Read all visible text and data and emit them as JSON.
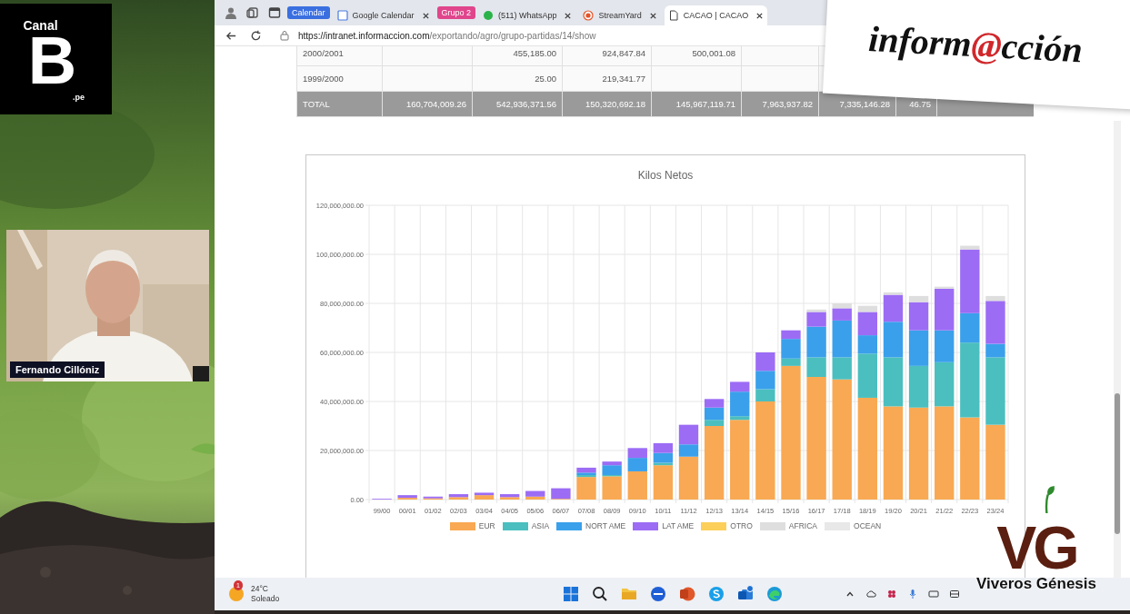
{
  "broadcast": {
    "channel_logo": {
      "top": "Canal",
      "letter": "B",
      "suffix": ".pe"
    },
    "guest": {
      "name": "Fernando Cillóniz"
    },
    "news_logo": {
      "before": "inform",
      "at": "@",
      "after": "cción"
    },
    "sponsor_logo": {
      "mark": "VG",
      "name": "Viveros Génesis"
    }
  },
  "browser": {
    "tabs": [
      {
        "kind": "group",
        "label": "Calendar",
        "color": "#3a6fe0"
      },
      {
        "kind": "tab",
        "label": "Google Calendar",
        "selected": false
      },
      {
        "kind": "group",
        "label": "Grupo 2",
        "color": "#e0468c"
      },
      {
        "kind": "tab",
        "label": "(511) WhatsApp",
        "selected": false
      },
      {
        "kind": "tab",
        "label": "StreamYard",
        "selected": false
      },
      {
        "kind": "tab",
        "label": "CACAO | CACAO",
        "selected": true
      }
    ],
    "address": {
      "host": "https://intranet.informaccion.com",
      "path": "/exportando/agro/grupo-partidas/14/show"
    }
  },
  "table": {
    "rows": [
      {
        "kind": "data",
        "column_1": "2000/2001",
        "column_3": "455,185.00",
        "column_4": "924,847.84",
        "column_5": "500,001.08"
      },
      {
        "kind": "data",
        "column_1": "1999/2000",
        "column_3": "25.00",
        "column_4": "219,341.77"
      },
      {
        "kind": "total",
        "column_1": "TOTAL",
        "column_2": "160,704,009.26",
        "column_3": "542,936,371.56",
        "column_4": "150,320,692.18",
        "column_5": "145,967,119.71",
        "column_6": "7,963,937.82",
        "column_7": "7,335,146.28",
        "column_8": "46.75"
      }
    ]
  },
  "chart_card": {
    "chart_data": {
      "type": "bar",
      "title": "Kilos Netos",
      "stacked": true,
      "grid": true,
      "categories": [
        "99/00",
        "00/01",
        "01/02",
        "02/03",
        "03/04",
        "04/05",
        "05/06",
        "06/07",
        "07/08",
        "08/09",
        "09/10",
        "10/11",
        "11/12",
        "12/13",
        "13/14",
        "14/15",
        "15/16",
        "16/17",
        "17/18",
        "18/19",
        "19/20",
        "20/21",
        "21/22",
        "22/23",
        "23/24"
      ],
      "ylim": [
        0,
        120000000
      ],
      "yticks": [
        {
          "value": 0,
          "label": "0.00"
        },
        {
          "value": 20000000,
          "label": "20,000,000.00"
        },
        {
          "value": 40000000,
          "label": "40,000,000.00"
        },
        {
          "value": 60000000,
          "label": "60,000,000.00"
        },
        {
          "value": 80000000,
          "label": "80,000,000.00"
        },
        {
          "value": 100000000,
          "label": "100,000,000.00"
        },
        {
          "value": 120000000,
          "label": "120,000,000.00"
        }
      ],
      "series": [
        {
          "name": "EUR",
          "color": "#f9a953",
          "values": [
            0,
            700000,
            500000,
            1000000,
            1800000,
            1000000,
            1200000,
            300000,
            9200000,
            9500000,
            11500000,
            14000000,
            17500000,
            30000000,
            32500000,
            40000000,
            54500000,
            50000000,
            49000000,
            41500000,
            38000000,
            37500000,
            38000000,
            33500000,
            30500000
          ]
        },
        {
          "name": "ASIA",
          "color": "#4bbfbf",
          "values": [
            0,
            0,
            0,
            0,
            0,
            0,
            0,
            0,
            800000,
            500000,
            0,
            1000000,
            0,
            2500000,
            1500000,
            5000000,
            3000000,
            8000000,
            9000000,
            18000000,
            20000000,
            17000000,
            18000000,
            30500000,
            27500000
          ]
        },
        {
          "name": "NORT AME",
          "color": "#3aa0eb",
          "values": [
            0,
            0,
            0,
            0,
            0,
            0,
            0,
            0,
            1000000,
            4000000,
            5500000,
            4000000,
            5000000,
            5000000,
            10000000,
            7500000,
            8000000,
            12500000,
            15000000,
            7500000,
            14500000,
            14500000,
            13000000,
            12000000,
            5500000
          ]
        },
        {
          "name": "LAT AME",
          "color": "#9c6cf5",
          "values": [
            300000,
            1100000,
            700000,
            1200000,
            1000000,
            1200000,
            2300000,
            4300000,
            2000000,
            1500000,
            4000000,
            4000000,
            8000000,
            3500000,
            4000000,
            7500000,
            3500000,
            6000000,
            5000000,
            9500000,
            11000000,
            11500000,
            17000000,
            26000000,
            17500000
          ]
        },
        {
          "name": "OTRO",
          "color": "#fccf5a",
          "values": [
            0,
            0,
            0,
            0,
            0,
            0,
            0,
            0,
            0,
            0,
            0,
            0,
            0,
            0,
            0,
            0,
            0,
            0,
            0,
            0,
            0,
            0,
            0,
            0,
            0
          ]
        },
        {
          "name": "AFRICA",
          "color": "#dedede",
          "values": [
            0,
            0,
            0,
            0,
            0,
            0,
            0,
            0,
            0,
            0,
            0,
            0,
            0,
            0,
            0,
            null,
            null,
            1000000,
            2000000,
            2500000,
            1000000,
            2500000,
            800000,
            1500000,
            2000000
          ]
        },
        {
          "name": "OCEAN",
          "color": "#e8e8e8",
          "values": [
            0,
            0,
            0,
            0,
            0,
            0,
            0,
            0,
            0,
            0,
            0,
            0,
            0,
            0,
            0,
            0,
            0,
            0,
            0,
            0,
            0,
            0,
            0,
            0,
            0
          ]
        }
      ]
    }
  },
  "taskbar": {
    "weather": {
      "temperature": "24°C",
      "condition": "Soleado",
      "badge": "1"
    },
    "apps": [
      {
        "kind": "start"
      },
      {
        "kind": "search"
      },
      {
        "kind": "folder"
      },
      {
        "kind": "circle"
      },
      {
        "kind": "slides"
      },
      {
        "kind": "skype"
      },
      {
        "kind": "mail"
      },
      {
        "kind": "browser"
      }
    ],
    "tray": [
      {
        "kind": "caret"
      },
      {
        "kind": "cloud"
      },
      {
        "kind": "dots"
      },
      {
        "kind": "mic"
      },
      {
        "kind": "keyboard"
      },
      {
        "kind": "window"
      }
    ]
  }
}
